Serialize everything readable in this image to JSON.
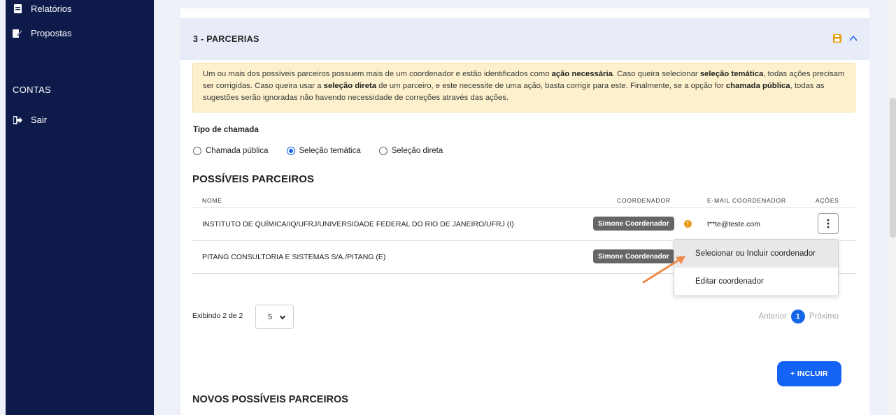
{
  "sidebar": {
    "items": [
      {
        "label": "Relatórios",
        "icon": "report-icon"
      },
      {
        "label": "Propostas",
        "icon": "edit-document-icon"
      }
    ],
    "section_heading": "CONTAS",
    "logout": {
      "label": "Sair",
      "icon": "sign-out-icon"
    }
  },
  "section": {
    "title": "3 - PARCERIAS"
  },
  "alert": {
    "t1": "Um ou mais dos possíveis parceiros possuem mais de um coordenador e estão identificados como ",
    "b1": "ação necessária",
    "t2": ". Caso queira selecionar ",
    "b2": "seleção temática",
    "t3": ", todas ações precisam ser corrigidas. Caso queira usar a ",
    "b3": "seleção direta",
    "t4": " de um parceiro, e este necessite de uma ação, basta corrigir para este. Finalmente, se a opção for ",
    "b4": "chamada pública",
    "t5": ", todas as sugestões serão ignoradas não havendo necessidade de correções através das ações."
  },
  "tipo_chamada": {
    "label": "Tipo de chamada",
    "options": [
      "Chamada pública",
      "Seleção temática",
      "Seleção direta"
    ],
    "selected": "Seleção temática"
  },
  "possiveis": {
    "title": "POSSÍVEIS PARCEIROS",
    "columns": [
      "NOME",
      "COORDENADOR",
      "E-MAIL COORDENADOR",
      "AÇÕES"
    ],
    "rows": [
      {
        "nome": "INSTITUTO DE QUÍMICA/IQ/UFRJ/UNIVERSIDADE FEDERAL DO RIO DE JANEIRO/UFRJ (I)",
        "coordenador": "Simone Coordenador",
        "email": "t**te@teste.com"
      },
      {
        "nome": "PITANG CONSULTORIA E SISTEMAS S/A./PITANG (E)",
        "coordenador": "Simone Coordenador",
        "email": ""
      }
    ]
  },
  "dropdown": {
    "items": [
      "Selecionar ou Incluir coordenador",
      "Editar coordenador"
    ]
  },
  "pagination": {
    "showing": "Exibindo 2 de 2",
    "page_size": "5",
    "prev": "Anterior",
    "current": "1",
    "next": "Próximo"
  },
  "buttons": {
    "incluir": "+ INCLUIR"
  },
  "novos": {
    "title": "NOVOS POSSÍVEIS PARCEIROS"
  },
  "colors": {
    "sidebar_bg": "#0d1a4a",
    "accent": "#1565e8",
    "alert_bg": "#fdf0cc",
    "warning": "#e8a013",
    "arrow": "#f08a4b"
  }
}
